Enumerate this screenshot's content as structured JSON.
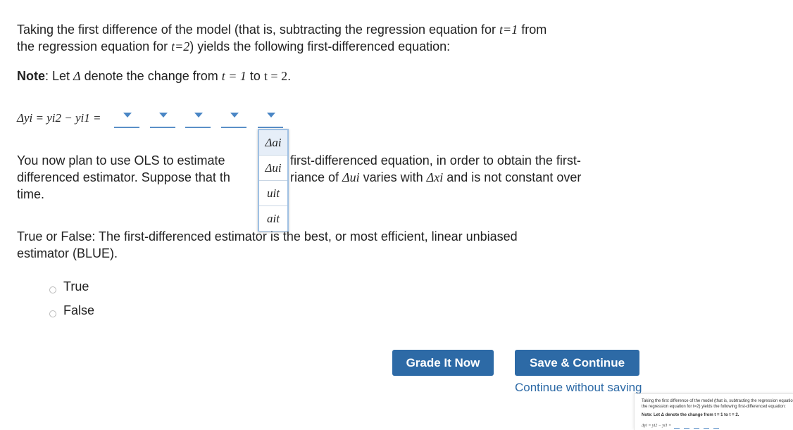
{
  "question": {
    "intro_part1": "Taking the first difference of the model (that is, subtracting the regression equation for ",
    "t1": "t=1",
    "intro_part2": " from",
    "intro_line2_part1": "the regression equation for ",
    "t2": "t=2",
    "intro_line2_part2": ") yields the following first-differenced equation:",
    "note_label": "Note",
    "note_text1": ": Let ",
    "delta": "Δ",
    "note_text2": " denote the change from ",
    "note_t1": "t = 1",
    "note_to": " to ",
    "note_t2": "t = 2",
    "note_end": "."
  },
  "equation": {
    "lhs": "Δyi = yi2 − yi1 ="
  },
  "dropdown_menu": {
    "options": [
      "Δai",
      "Δui",
      "uit",
      "ait"
    ]
  },
  "paragraph2": {
    "line1_left": "You now plan to use OLS to estimate ",
    "line1_right": "first-differenced equation, in order to obtain the first-",
    "line2_left": "differenced estimator. Suppose that th",
    "line2_right_a": "riance of ",
    "line2_du": "Δui",
    "line2_right_b": " varies with ",
    "line2_dx": "Δxi",
    "line2_right_c": " and is not constant over",
    "line3": "time."
  },
  "tf": {
    "line1_left": "True or False: The first-differenced es",
    "line1_hidden": "tim",
    "line1_right": "ator is the best, or most efficient, linear unbiased",
    "line2": "estimator (BLUE)."
  },
  "options": {
    "true_label": "True",
    "false_label": "False"
  },
  "buttons": {
    "grade": "Grade It Now",
    "save": "Save & Continue",
    "continue_link": "Continue without saving"
  },
  "thumbnail": {
    "line1": "Taking the first difference of the model (that is, subtracting the regression equation",
    "line2": "the regression equation for t=2) yields the following first-differenced equation:",
    "line3": "Note: Let Δ denote the change from t = 1 to t = 2.",
    "line4": "Δyi = yi2 − yi1 ="
  },
  "colors": {
    "button_bg": "#2d6aa6",
    "link": "#2d6aa6",
    "dropdown_arrow": "#4a86c5"
  }
}
